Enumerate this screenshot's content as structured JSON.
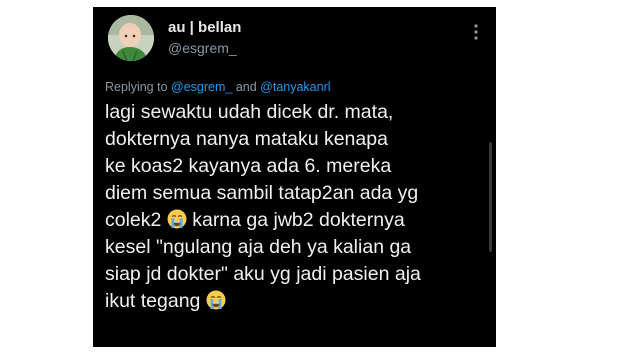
{
  "tweet": {
    "display_name": "au | bellan",
    "handle": "@esgrem_",
    "reply": {
      "prefix": "Replying to ",
      "mention_1": "@esgrem_",
      "conjunction": " and ",
      "mention_2": "@tanyakanrl"
    },
    "text_lines": [
      "lagi sewaktu udah dicek dr. mata,",
      "dokternya nanya mataku kenapa",
      "ke koas2 kayanya ada 6. mereka",
      "diem semua sambil tatap2an ada yg",
      {
        "before": "colek2",
        "emoji": "loudly-crying-face",
        "after": "karna ga jwb2 dokternya"
      },
      "kesel \"ngulang aja deh ya kalian ga",
      "siap jd dokter\" aku yg jadi pasien aja",
      {
        "before": "ikut tegang",
        "emoji": "loudly-crying-face",
        "after": ""
      }
    ]
  },
  "colors": {
    "background": "#000000",
    "text": "#e7e9ea",
    "secondary_text": "#8b98a5",
    "link": "#1d9bf0"
  },
  "icons": {
    "more": "more-vertical-icon",
    "emoji": "loudly-crying-face-emoji"
  }
}
